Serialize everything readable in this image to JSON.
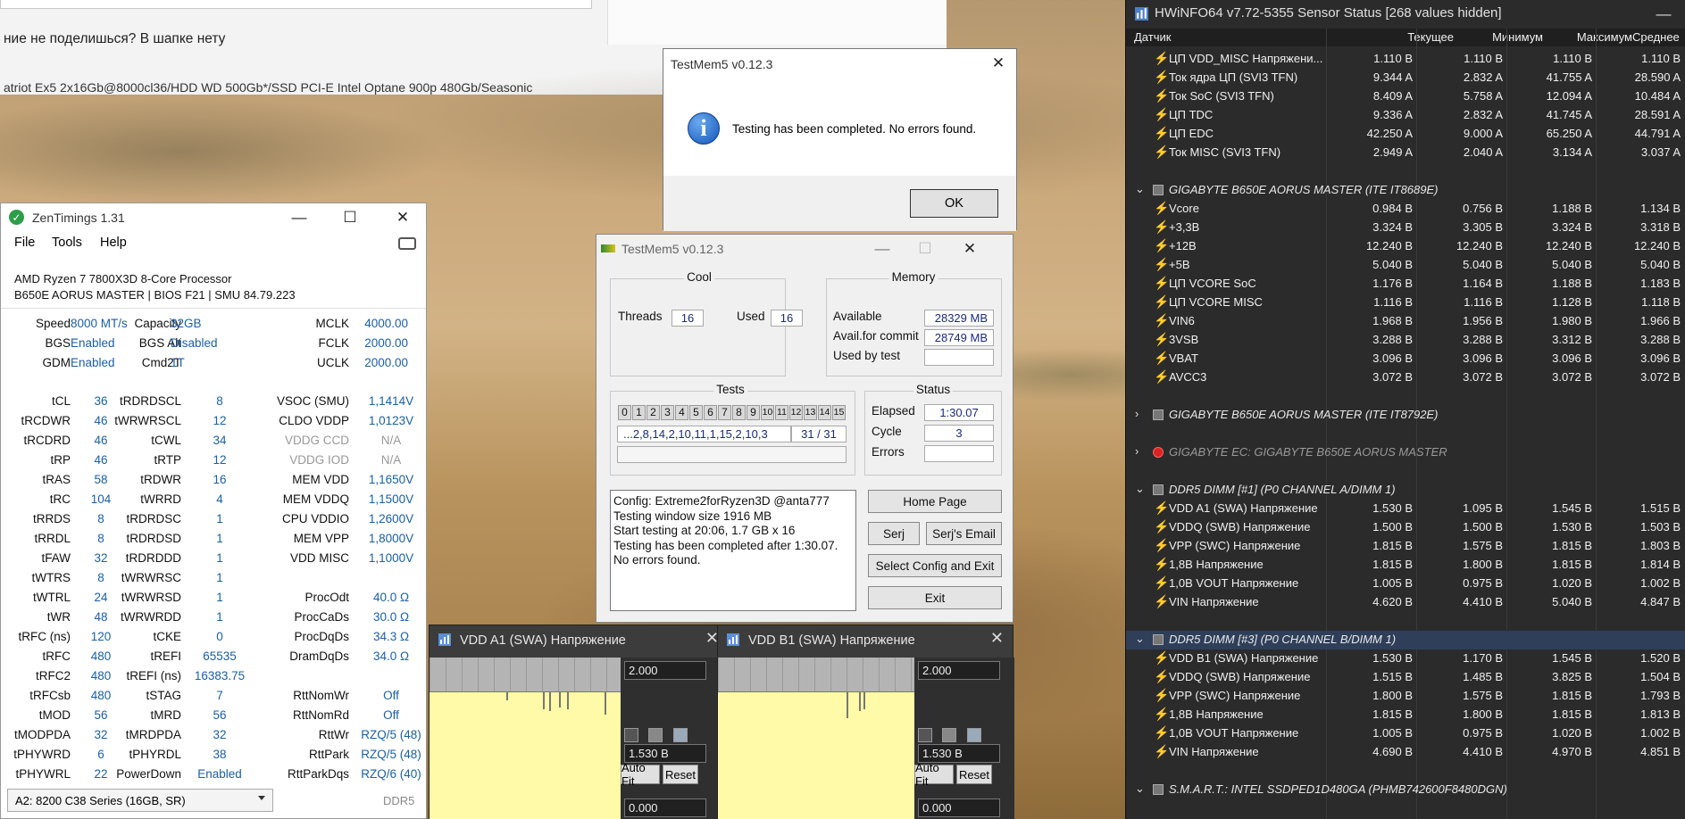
{
  "forum": {
    "line1": "ние не поделишься? В шапке нету",
    "line2": "atriot Ex5 2x16Gb@8000cl36/HDD WD 500Gb*/SSD PCI-E Intel Optane 900p 480Gb/Seasonic"
  },
  "zen": {
    "title": "ZenTimings 1.31",
    "menu": [
      "File",
      "Tools",
      "Help"
    ],
    "cpu": "AMD Ryzen 7 7800X3D 8-Core Processor",
    "board": "B650E AORUS MASTER | BIOS F21 | SMU 84.79.223",
    "top": [
      [
        "Speed",
        "8000 MT/s",
        "Capacity",
        "32GB",
        "MCLK",
        "4000.00"
      ],
      [
        "BGS",
        "Enabled",
        "BGS Alt",
        "Disabled",
        "FCLK",
        "2000.00"
      ],
      [
        "GDM",
        "Enabled",
        "Cmd2T",
        "1T",
        "UCLK",
        "2000.00"
      ]
    ],
    "rows": [
      [
        "tCL",
        "36",
        "tRDRDSCL",
        "8",
        "VSOC (SMU)",
        "1,1414V"
      ],
      [
        "tRCDWR",
        "46",
        "tWRWRSCL",
        "12",
        "CLDO VDDP",
        "1,0123V"
      ],
      [
        "tRCDRD",
        "46",
        "tCWL",
        "34",
        "VDDG CCD",
        "N/A"
      ],
      [
        "tRP",
        "46",
        "tRTP",
        "12",
        "VDDG IOD",
        "N/A"
      ],
      [
        "tRAS",
        "58",
        "tRDWR",
        "16",
        "MEM VDD",
        "1,1650V"
      ],
      [
        "tRC",
        "104",
        "tWRRD",
        "4",
        "MEM VDDQ",
        "1,1500V"
      ],
      [
        "tRRDS",
        "8",
        "tRDRDSC",
        "1",
        "CPU VDDIO",
        "1,2600V"
      ],
      [
        "tRRDL",
        "8",
        "tRDRDSD",
        "1",
        "MEM VPP",
        "1,8000V"
      ],
      [
        "tFAW",
        "32",
        "tRDRDDD",
        "1",
        "VDD MISC",
        "1,1000V"
      ],
      [
        "tWTRS",
        "8",
        "tWRWRSC",
        "1",
        "",
        ""
      ],
      [
        "tWTRL",
        "24",
        "tWRWRSD",
        "1",
        "ProcOdt",
        "40.0 Ω"
      ],
      [
        "tWR",
        "48",
        "tWRWRDD",
        "1",
        "ProcCaDs",
        "30.0 Ω"
      ],
      [
        "tRFC (ns)",
        "120",
        "tCKE",
        "0",
        "ProcDqDs",
        "34.3 Ω"
      ],
      [
        "tRFC",
        "480",
        "tREFI",
        "65535",
        "DramDqDs",
        "34.0 Ω"
      ],
      [
        "tRFC2",
        "480",
        "tREFI (ns)",
        "16383.75",
        "",
        ""
      ],
      [
        "tRFCsb",
        "480",
        "tSTAG",
        "7",
        "RttNomWr",
        "Off"
      ],
      [
        "tMOD",
        "56",
        "tMRD",
        "56",
        "RttNomRd",
        "Off"
      ],
      [
        "tMODPDA",
        "32",
        "tMRDPDA",
        "32",
        "RttWr",
        "RZQ/5 (48)"
      ],
      [
        "tPHYWRD",
        "6",
        "tPHYRDL",
        "38",
        "RttPark",
        "RZQ/5 (48)"
      ],
      [
        "tPHYWRL",
        "22",
        "PowerDown",
        "Enabled",
        "RttParkDqs",
        "RZQ/6 (40)"
      ]
    ],
    "profile": "A2: 8200 C38 Series (16GB, SR)",
    "ddr": "DDR5"
  },
  "dialog": {
    "title": "TestMem5 v0.12.3",
    "message": "Testing has been completed. No errors found.",
    "ok": "OK"
  },
  "tm": {
    "title": "TestMem5 v0.12.3",
    "cool": "Cool",
    "threads_label": "Threads",
    "threads": "16",
    "used_label": "Used",
    "used": "16",
    "memory": "Memory",
    "available_label": "Available",
    "available": "28329 MB",
    "commit_label": "Avail.for commit",
    "commit": "28749 MB",
    "usedby_label": "Used by test",
    "usedby": "",
    "tests": "Tests",
    "test_boxes": [
      "0",
      "1",
      "2",
      "3",
      "4",
      "5",
      "6",
      "7",
      "8",
      "9",
      "10",
      "11",
      "12",
      "13",
      "14",
      "15"
    ],
    "sequence": "...2,8,14,2,10,11,1,15,2,10,3",
    "progress": "31 / 31",
    "status": "Status",
    "elapsed_label": "Elapsed",
    "elapsed": "1:30.07",
    "cycle_label": "Cycle",
    "cycle": "3",
    "errors_label": "Errors",
    "errors": "",
    "log": "Config: Extreme2forRyzen3D @anta777\nTesting window size 1916 MB\nStart testing at 20:06, 1.7 GB x 16\nTesting has been completed after 1:30.07.\nNo errors found.",
    "home": "Home Page",
    "serj": "Serj",
    "serj_email": "Serj's Email",
    "select": "Select Config and Exit",
    "exit": "Exit"
  },
  "graphs": [
    {
      "title": "VDD A1 (SWA) Напряжение",
      "max": "2.000",
      "cur": "1.530 В",
      "min": "0.000",
      "autofit": "Auto Fit",
      "reset": "Reset"
    },
    {
      "title": "VDD B1 (SWA) Напряжение",
      "max": "2.000",
      "cur": "1.530 В",
      "min": "0.000",
      "autofit": "Auto Fit",
      "reset": "Reset"
    }
  ],
  "hw": {
    "title": "HWiNFO64 v7.72-5355 Sensor Status [268 values hidden]",
    "cols": [
      "Датчик",
      "Текущее",
      "Минимум",
      "Максимум",
      "Среднее"
    ],
    "items": [
      {
        "t": "r",
        "n": "ЦП VDD_MISC Напряжени...",
        "v": [
          "1.110 В",
          "1.110 В",
          "1.110 В",
          "1.110 В"
        ]
      },
      {
        "t": "r",
        "n": "Ток ядра ЦП (SVI3 TFN)",
        "v": [
          "9.344 A",
          "2.832 A",
          "41.755 A",
          "28.590 A"
        ]
      },
      {
        "t": "r",
        "n": "Ток SoC (SVI3 TFN)",
        "v": [
          "8.409 A",
          "5.758 A",
          "12.094 A",
          "10.484 A"
        ]
      },
      {
        "t": "r",
        "n": "ЦП TDC",
        "v": [
          "9.336 A",
          "2.832 A",
          "41.745 A",
          "28.591 A"
        ]
      },
      {
        "t": "r",
        "n": "ЦП EDC",
        "v": [
          "42.250 A",
          "9.000 A",
          "65.250 A",
          "44.791 A"
        ]
      },
      {
        "t": "r",
        "n": "Ток MISC (SVI3 TFN)",
        "v": [
          "2.949 A",
          "2.040 A",
          "3.134 A",
          "3.037 A"
        ]
      },
      {
        "t": "b"
      },
      {
        "t": "g",
        "n": "GIGABYTE B650E AORUS MASTER (ITE IT8689E)",
        "open": true
      },
      {
        "t": "r",
        "n": "Vcore",
        "v": [
          "0.984 В",
          "0.756 В",
          "1.188 В",
          "1.134 В"
        ]
      },
      {
        "t": "r",
        "n": "+3,3В",
        "v": [
          "3.324 В",
          "3.305 В",
          "3.324 В",
          "3.318 В"
        ]
      },
      {
        "t": "r",
        "n": "+12В",
        "v": [
          "12.240 В",
          "12.240 В",
          "12.240 В",
          "12.240 В"
        ]
      },
      {
        "t": "r",
        "n": "+5В",
        "v": [
          "5.040 В",
          "5.040 В",
          "5.040 В",
          "5.040 В"
        ]
      },
      {
        "t": "r",
        "n": "ЦП VCORE SoC",
        "v": [
          "1.176 В",
          "1.164 В",
          "1.188 В",
          "1.183 В"
        ]
      },
      {
        "t": "r",
        "n": "ЦП VCORE MISC",
        "v": [
          "1.116 В",
          "1.116 В",
          "1.128 В",
          "1.118 В"
        ]
      },
      {
        "t": "r",
        "n": "VIN6",
        "v": [
          "1.968 В",
          "1.956 В",
          "1.980 В",
          "1.966 В"
        ]
      },
      {
        "t": "r",
        "n": "3VSB",
        "v": [
          "3.288 В",
          "3.288 В",
          "3.312 В",
          "3.288 В"
        ]
      },
      {
        "t": "r",
        "n": "VBAT",
        "v": [
          "3.096 В",
          "3.096 В",
          "3.096 В",
          "3.096 В"
        ]
      },
      {
        "t": "r",
        "n": "AVCC3",
        "v": [
          "3.072 В",
          "3.072 В",
          "3.072 В",
          "3.072 В"
        ]
      },
      {
        "t": "b"
      },
      {
        "t": "g",
        "n": "GIGABYTE B650E AORUS MASTER (ITE IT8792E)",
        "open": false
      },
      {
        "t": "b"
      },
      {
        "t": "g",
        "n": "GIGABYTE EC: GIGABYTE B650E AORUS MASTER",
        "open": false,
        "err": true
      },
      {
        "t": "b"
      },
      {
        "t": "g",
        "n": "DDR5 DIMM [#1] (P0 CHANNEL A/DIMM 1)",
        "open": true
      },
      {
        "t": "r",
        "n": "VDD A1 (SWA) Напряжение",
        "v": [
          "1.530 В",
          "1.095 В",
          "1.545 В",
          "1.515 В"
        ]
      },
      {
        "t": "r",
        "n": "VDDQ (SWB) Напряжение",
        "v": [
          "1.500 В",
          "1.500 В",
          "1.530 В",
          "1.503 В"
        ]
      },
      {
        "t": "r",
        "n": "VPP (SWC) Напряжение",
        "v": [
          "1.815 В",
          "1.575 В",
          "1.815 В",
          "1.803 В"
        ]
      },
      {
        "t": "r",
        "n": "1,8В Напряжение",
        "v": [
          "1.815 В",
          "1.800 В",
          "1.815 В",
          "1.814 В"
        ]
      },
      {
        "t": "r",
        "n": "1,0В VOUT Напряжение",
        "v": [
          "1.005 В",
          "0.975 В",
          "1.020 В",
          "1.002 В"
        ]
      },
      {
        "t": "r",
        "n": "VIN Напряжение",
        "v": [
          "4.620 В",
          "4.410 В",
          "5.040 В",
          "4.847 В"
        ]
      },
      {
        "t": "b"
      },
      {
        "t": "g",
        "n": "DDR5 DIMM [#3] (P0 CHANNEL B/DIMM 1)",
        "open": true,
        "sel": true
      },
      {
        "t": "r",
        "n": "VDD B1 (SWA) Напряжение",
        "v": [
          "1.530 В",
          "1.170 В",
          "1.545 В",
          "1.520 В"
        ]
      },
      {
        "t": "r",
        "n": "VDDQ (SWB) Напряжение",
        "v": [
          "1.515 В",
          "1.485 В",
          "3.825 В",
          "1.504 В"
        ]
      },
      {
        "t": "r",
        "n": "VPP (SWC) Напряжение",
        "v": [
          "1.800 В",
          "1.575 В",
          "1.815 В",
          "1.793 В"
        ]
      },
      {
        "t": "r",
        "n": "1,8В Напряжение",
        "v": [
          "1.815 В",
          "1.800 В",
          "1.815 В",
          "1.813 В"
        ]
      },
      {
        "t": "r",
        "n": "1,0В VOUT Напряжение",
        "v": [
          "1.005 В",
          "0.975 В",
          "1.020 В",
          "1.002 В"
        ]
      },
      {
        "t": "r",
        "n": "VIN Напряжение",
        "v": [
          "4.690 В",
          "4.410 В",
          "4.970 В",
          "4.851 В"
        ]
      },
      {
        "t": "b"
      },
      {
        "t": "g",
        "n": "S.M.A.R.T.: INTEL SSDPED1D480GA (PHMB742600F8480DGN)",
        "open": true
      }
    ]
  }
}
